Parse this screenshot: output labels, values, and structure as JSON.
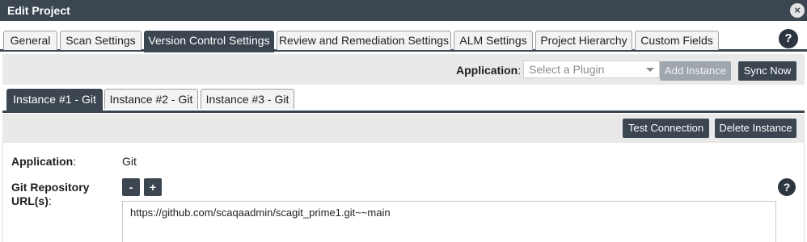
{
  "dialog": {
    "title": "Edit Project",
    "close_icon": "×"
  },
  "tabs": [
    {
      "label": "General"
    },
    {
      "label": "Scan Settings"
    },
    {
      "label": "Version Control Settings"
    },
    {
      "label": "Review and Remediation Settings"
    },
    {
      "label": "ALM Settings"
    },
    {
      "label": "Project Hierarchy"
    },
    {
      "label": "Custom Fields"
    }
  ],
  "active_tab": "Version Control Settings",
  "help_icon": "?",
  "application_bar": {
    "label": "Application",
    "colon": ":",
    "select_placeholder": "Select a Plugin",
    "add_instance_label": "Add Instance",
    "sync_now_label": "Sync Now"
  },
  "instance_tabs": [
    {
      "label": "Instance #1 - Git"
    },
    {
      "label": "Instance #2 - Git"
    },
    {
      "label": "Instance #3 - Git"
    }
  ],
  "actions": {
    "test_connection_label": "Test Connection",
    "delete_instance_label": "Delete Instance"
  },
  "form": {
    "application_label": "Application",
    "application_colon": ":",
    "application_value": "Git",
    "repo_label_line1": "Git Repository",
    "repo_label_line2": "URL(s)",
    "repo_colon": ":",
    "minus_label": "-",
    "plus_label": "+",
    "repo_url_value": "https://github.com/scaqaadmin/scagit_prime1.git~~main"
  },
  "colors": {
    "dark": "#3b4650",
    "disabled": "#9fa6ad",
    "bar_bg": "#e9e9e9"
  }
}
